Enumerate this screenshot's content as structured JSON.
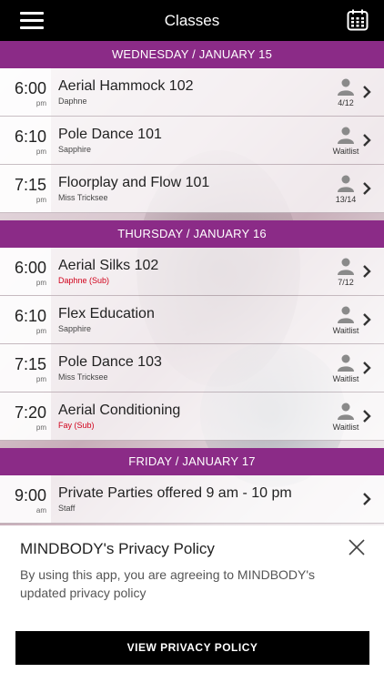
{
  "header": {
    "title": "Classes",
    "menu_icon": "hamburger-menu-icon",
    "calendar_icon": "calendar-icon"
  },
  "days": [
    {
      "label": "WEDNESDAY / JANUARY 15",
      "classes": [
        {
          "time": "6:00",
          "ampm": "pm",
          "name": "Aerial Hammock 102",
          "teacher": "Daphne",
          "sub": false,
          "status": "4/12"
        },
        {
          "time": "6:10",
          "ampm": "pm",
          "name": "Pole Dance 101",
          "teacher": "Sapphire",
          "sub": false,
          "status": "Waitlist"
        },
        {
          "time": "7:15",
          "ampm": "pm",
          "name": "Floorplay and Flow 101",
          "teacher": "Miss Tricksee",
          "sub": false,
          "status": "13/14"
        }
      ]
    },
    {
      "label": "THURSDAY / JANUARY 16",
      "classes": [
        {
          "time": "6:00",
          "ampm": "pm",
          "name": "Aerial Silks 102",
          "teacher": "Daphne (Sub)",
          "sub": true,
          "status": "7/12"
        },
        {
          "time": "6:10",
          "ampm": "pm",
          "name": "Flex Education",
          "teacher": "Sapphire",
          "sub": false,
          "status": "Waitlist"
        },
        {
          "time": "7:15",
          "ampm": "pm",
          "name": "Pole Dance 103",
          "teacher": "Miss Tricksee",
          "sub": false,
          "status": "Waitlist"
        },
        {
          "time": "7:20",
          "ampm": "pm",
          "name": "Aerial Conditioning",
          "teacher": "Fay (Sub)",
          "sub": true,
          "status": "Waitlist"
        }
      ]
    },
    {
      "label": "FRIDAY / JANUARY 17",
      "classes": [
        {
          "time": "9:00",
          "ampm": "am",
          "name": "Private Parties offered 9 am - 10 pm",
          "teacher": "Staff",
          "sub": false,
          "status": ""
        }
      ]
    }
  ],
  "privacy": {
    "title": "MINDBODY's Privacy Policy",
    "body": "By using this app, you are agreeing to MINDBODY's updated privacy policy",
    "button": "VIEW PRIVACY POLICY"
  },
  "colors": {
    "accent": "#8b2b87",
    "topbar": "#000000",
    "sub_teacher": "#d0001a"
  }
}
